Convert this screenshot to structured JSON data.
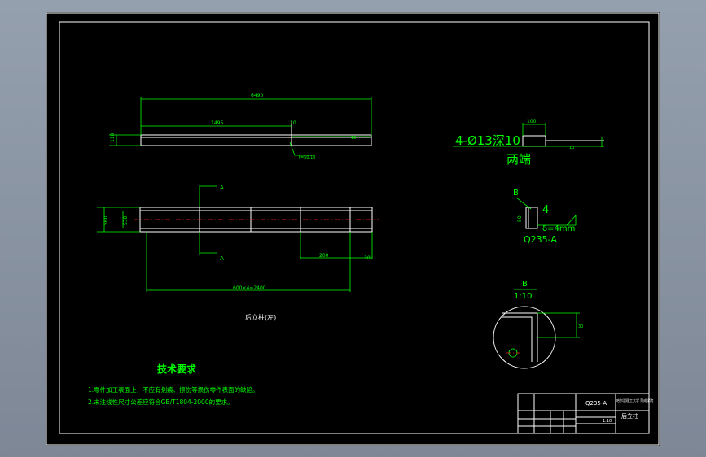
{
  "colors": {
    "background": "#000000",
    "outline": "#ffffff",
    "dimension": "#00ff00",
    "centerline": "#ff2020",
    "viewport_bg": "#8a94a3"
  },
  "top_view": {
    "overall_dim": "6490",
    "left_dim": "1495",
    "height_dim": "110",
    "section_mark": "10",
    "right_dim": "10",
    "leader_note": "t=50.10"
  },
  "section_label_a": "A",
  "front_view": {
    "height_outer": "560",
    "height_inner": "530",
    "spacing_dim": "200",
    "end_dim": "30",
    "total_dim": "600×4=2400",
    "caption": "后立柱(左)"
  },
  "hole_note": {
    "main": "4-Ø13深10",
    "sub": "两端",
    "dim_top": "100",
    "dim_right": "10"
  },
  "weld_detail": {
    "label_b": "B",
    "size": "4",
    "height": "50",
    "thickness": "δ=4mm",
    "material": "Q235-A"
  },
  "detail_b": {
    "label": "B",
    "scale": "1:10",
    "dim": "30"
  },
  "tech_req": {
    "title": "技术要求",
    "items": [
      "1.零件加工表面上，不应有划痕、擦伤等损伤零件表面的缺陷。",
      "2.未注线性尺寸公差应符合GB/T1804-2000的要求。"
    ]
  },
  "title_block": {
    "material": "Q235-A",
    "school": "哈尔滨理工大学 荣成学院",
    "part_name": "后立柱",
    "scale": "1:10"
  }
}
